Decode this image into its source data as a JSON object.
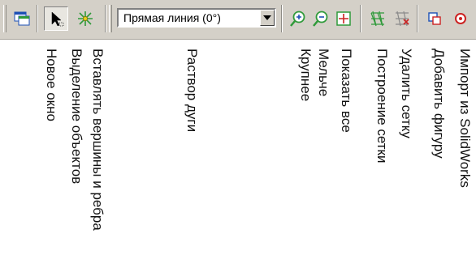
{
  "toolbar": {
    "line_type": {
      "selected": "Прямая линия (0°)"
    },
    "buttons": [
      {
        "icon": "new-window-icon"
      },
      {
        "icon": "select-objects-icon"
      },
      {
        "icon": "insert-vertices-icon"
      },
      {
        "icon": "zoom-in-icon"
      },
      {
        "icon": "zoom-out-icon"
      },
      {
        "icon": "show-all-icon"
      },
      {
        "icon": "build-mesh-icon"
      },
      {
        "icon": "delete-mesh-icon"
      },
      {
        "icon": "add-shape-icon"
      },
      {
        "icon": "import-solidworks-icon"
      }
    ]
  },
  "labels": {
    "new_window": "Новое окно",
    "select_objects": "Выделение объектов",
    "insert_vertices": "Вставлять вершины и ребра",
    "arc_angle": "Раствор дуги",
    "zoom_in": "Крупнее",
    "zoom_out": "Мельче",
    "show_all": "Показать все",
    "build_mesh": "Построение сетки",
    "delete_mesh": "Удалить сетку",
    "add_shape": "Добавить фигуру",
    "import_solidworks": "Импорт из SolidWorks"
  },
  "colors": {
    "toolbar_bg": "#d4d0c8",
    "icon_blue": "#1c4fb5",
    "icon_green": "#2f9a3a",
    "icon_red": "#cc2222"
  }
}
